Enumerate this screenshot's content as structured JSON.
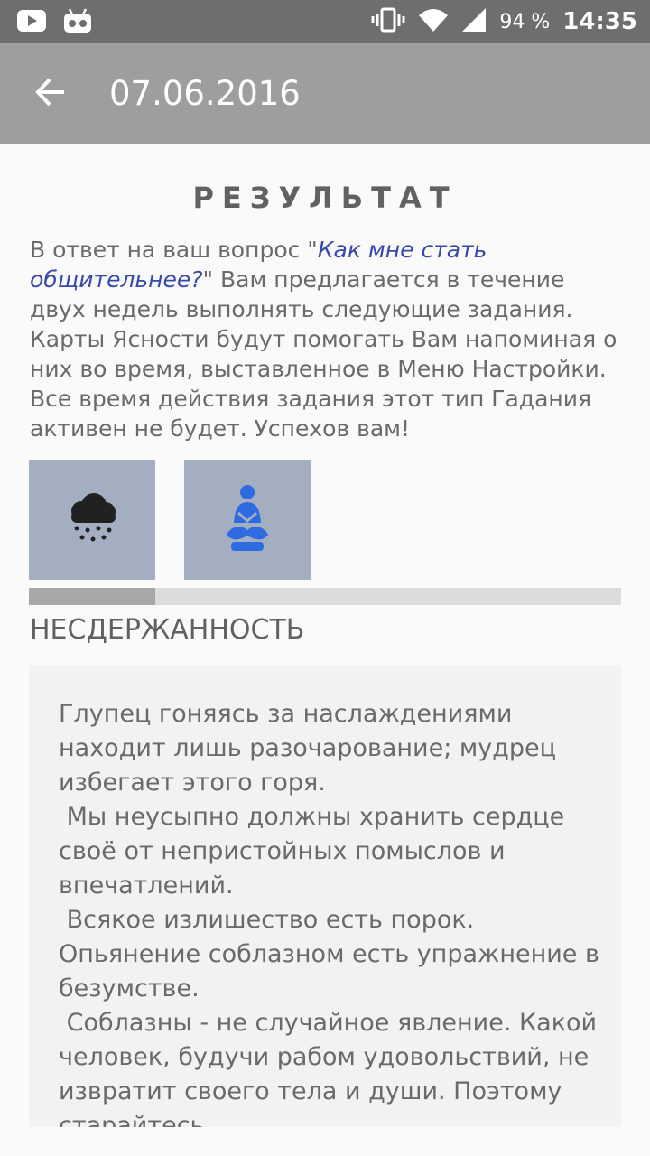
{
  "status_bar": {
    "battery": "94 %",
    "time": "14:35"
  },
  "app_bar": {
    "title": "07.06.2016"
  },
  "result": {
    "heading": "РЕЗУЛЬТАТ",
    "intro_before": "В ответ на ваш вопрос \"",
    "question": "Как мне стать общительнее?",
    "intro_after": "\" Вам предлагается в течение двух недель выполнять следующие задания. Карты Ясности будут помогать Вам напоминая о них во время, выставленное в Меню Настройки. Все время действия задания этот тип Гадания активен не будет. Успехов вам!",
    "question_color": "#3949ab"
  },
  "cards": [
    {
      "icon": "rain-cloud-icon"
    },
    {
      "icon": "meditation-icon"
    }
  ],
  "progress": {
    "fraction": 0.213
  },
  "section": {
    "title": "НЕСДЕРЖАННОСТЬ",
    "text": "Глупец гоняясь за наслаждениями находит лишь разочарование; мудрец избегает этого горя.\n Мы неусыпно должны хранить сердце своё от непристойных помыслов и впечатлений.\n Всякое излишество есть порок. Опьянение соблазном есть упражнение в безумстве.\n Соблазны - не случайное явление. Какой человек, будучи рабом удовольствий, не извратит своего тела и души. Поэтому старайтесь"
  }
}
